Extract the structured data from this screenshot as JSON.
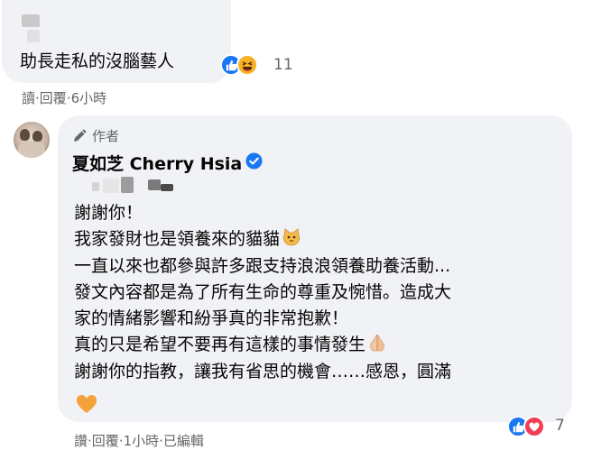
{
  "comment1": {
    "text": "助長走私的沒腦藝人",
    "reaction_count": "11",
    "reactions": [
      "like-icon",
      "haha-icon"
    ],
    "actions": {
      "like": "讀",
      "sep1": "·",
      "reply": "回覆",
      "sep2": "·",
      "time": "6小時"
    }
  },
  "comment2": {
    "author_label": "作者",
    "name": "夏如芝 Cherry Hsia",
    "lines": [
      "謝謝你！",
      "我家發財也是領養來的貓貓",
      "一直以來也都參與許多跟支持浪浪領養助養活動...",
      "發文內容都是為了所有生命的尊重及惋惜。造成大",
      "家的情緒影響和紛爭真的非常抱歉！",
      "真的只是希望不要再有這樣的事情發生",
      "謝謝你的指教，讓我有省思的機會……感恩，圓滿"
    ],
    "reaction_count": "7",
    "reactions": [
      "like-icon",
      "love-icon"
    ],
    "actions": {
      "like": "讚",
      "sep1": "·",
      "reply": "回覆",
      "sep2": "·",
      "time": "1小時",
      "sep3": "·",
      "edited": "已編輯"
    }
  },
  "colors": {
    "bubble": "#f0f2f5",
    "like_blue": "#1877f2",
    "meta_gray": "#65676b",
    "love_red": "#f33e58",
    "haha_yellow": "#f7b125"
  }
}
